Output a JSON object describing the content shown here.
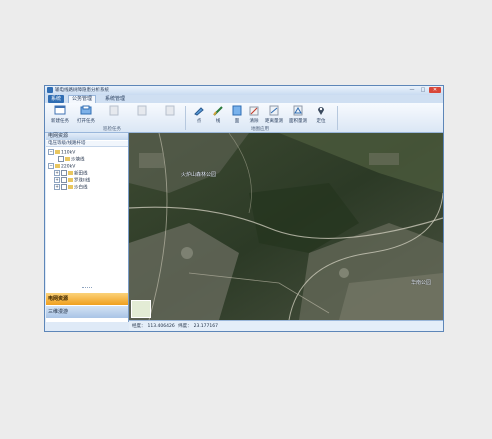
{
  "window": {
    "title": "输电线路树障隐患分析系统"
  },
  "titlebar_buttons": {
    "minimize": "—",
    "maximize": "□",
    "close": "✕"
  },
  "menu": {
    "system": "系统",
    "public_management": "公务管理",
    "system_management": "系统管理"
  },
  "ribbon": {
    "task_buttons": [
      {
        "label": "新建任务",
        "icon": "new-task-icon"
      },
      {
        "label": "打开任务",
        "icon": "open-task-icon"
      },
      {
        "label": "",
        "icon": "disabled-tool-icon"
      },
      {
        "label": "",
        "icon": "disabled-tool-icon"
      },
      {
        "label": "",
        "icon": "disabled-tool-icon"
      }
    ],
    "task_group_label": "巡检任务",
    "map_buttons": [
      {
        "label": "点",
        "icon": "point-icon"
      },
      {
        "label": "线",
        "icon": "line-icon"
      },
      {
        "label": "面",
        "icon": "polygon-icon"
      },
      {
        "label": "清除",
        "icon": "clear-icon"
      },
      {
        "label": "距离量测",
        "icon": "distance-measure-icon"
      },
      {
        "label": "面积量测",
        "icon": "area-measure-icon"
      },
      {
        "label": "定位",
        "icon": "locate-icon"
      }
    ],
    "map_group_label": "地图应用"
  },
  "sidebar": {
    "panel_title": "电网资源",
    "sub_title": "电压等级/线路杆塔",
    "tree": [
      {
        "label": "110kV",
        "level": 0,
        "expander": "−"
      },
      {
        "label": "沙塘线",
        "level": 1,
        "expander": ""
      },
      {
        "label": "220kV",
        "level": 0,
        "expander": "−"
      },
      {
        "label": "新田线",
        "level": 1,
        "expander": "+"
      },
      {
        "label": "罗珠II线",
        "level": 1,
        "expander": "+"
      },
      {
        "label": "沙白线",
        "level": 1,
        "expander": "+"
      }
    ],
    "nav_items": [
      "电网资源",
      "三维漫游"
    ]
  },
  "map": {
    "labels": [
      "火炉山森林公园",
      "华南公园"
    ]
  },
  "status": {
    "longitude_label": "经度：",
    "longitude_value": "113.406426",
    "latitude_label": "纬度：",
    "latitude_value": "23.177167"
  },
  "colors": {
    "accent": "#2f6db3",
    "nav_active": "#f0a01e",
    "close": "#d8473a"
  }
}
